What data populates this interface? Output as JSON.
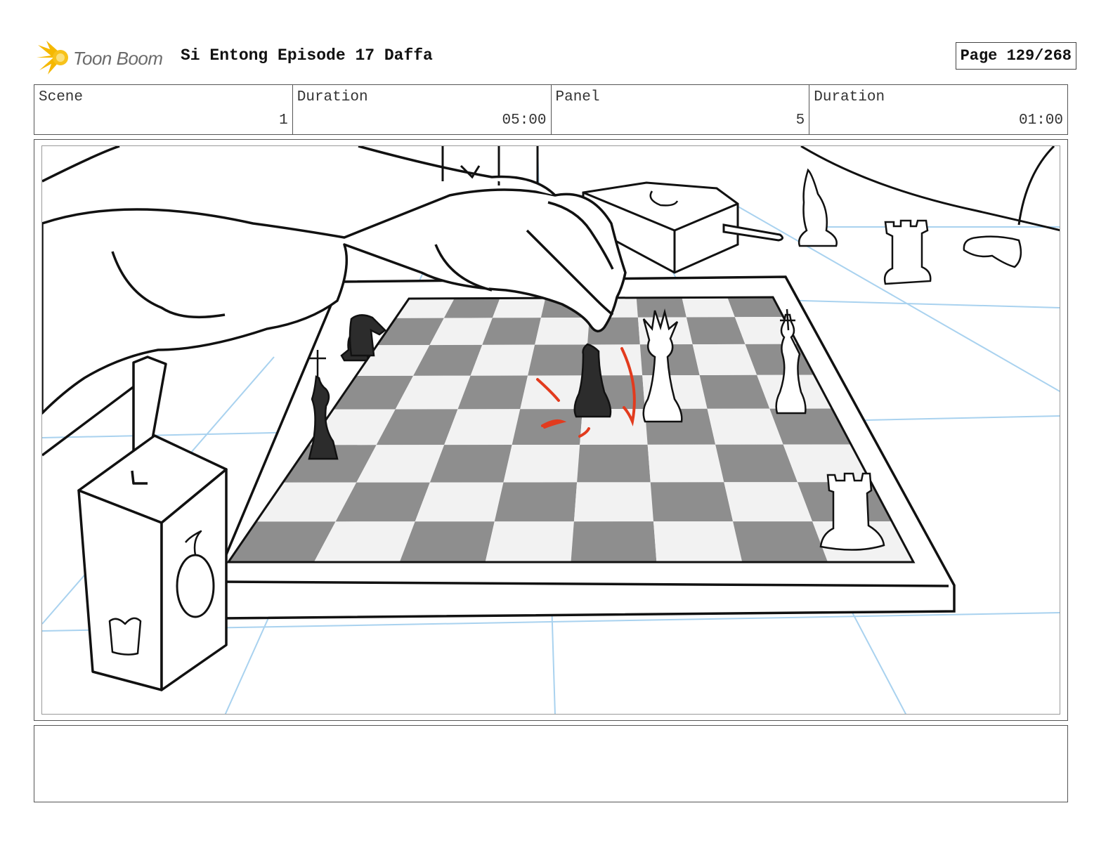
{
  "header": {
    "logo_icon": "toon-boom-sun-icon",
    "logo_text": "Toon Boom",
    "project_title": "Si Entong Episode 17 Daffa",
    "page_label": "Page 129/268"
  },
  "info": {
    "scene_label": "Scene",
    "scene_value": "1",
    "scene_duration_label": "Duration",
    "scene_duration_value": "05:00",
    "panel_label": "Panel",
    "panel_value": "5",
    "panel_duration_label": "Duration",
    "panel_duration_value": "01:00"
  },
  "panel": {
    "drawing": "chess-board-sketch",
    "colors": {
      "perspective_lines": "#a9d2ef",
      "motion_marks": "#e23b1e",
      "dark_square": "#8e8e8e",
      "light_square": "#f2f2f2"
    }
  },
  "notes": {
    "text": ""
  }
}
